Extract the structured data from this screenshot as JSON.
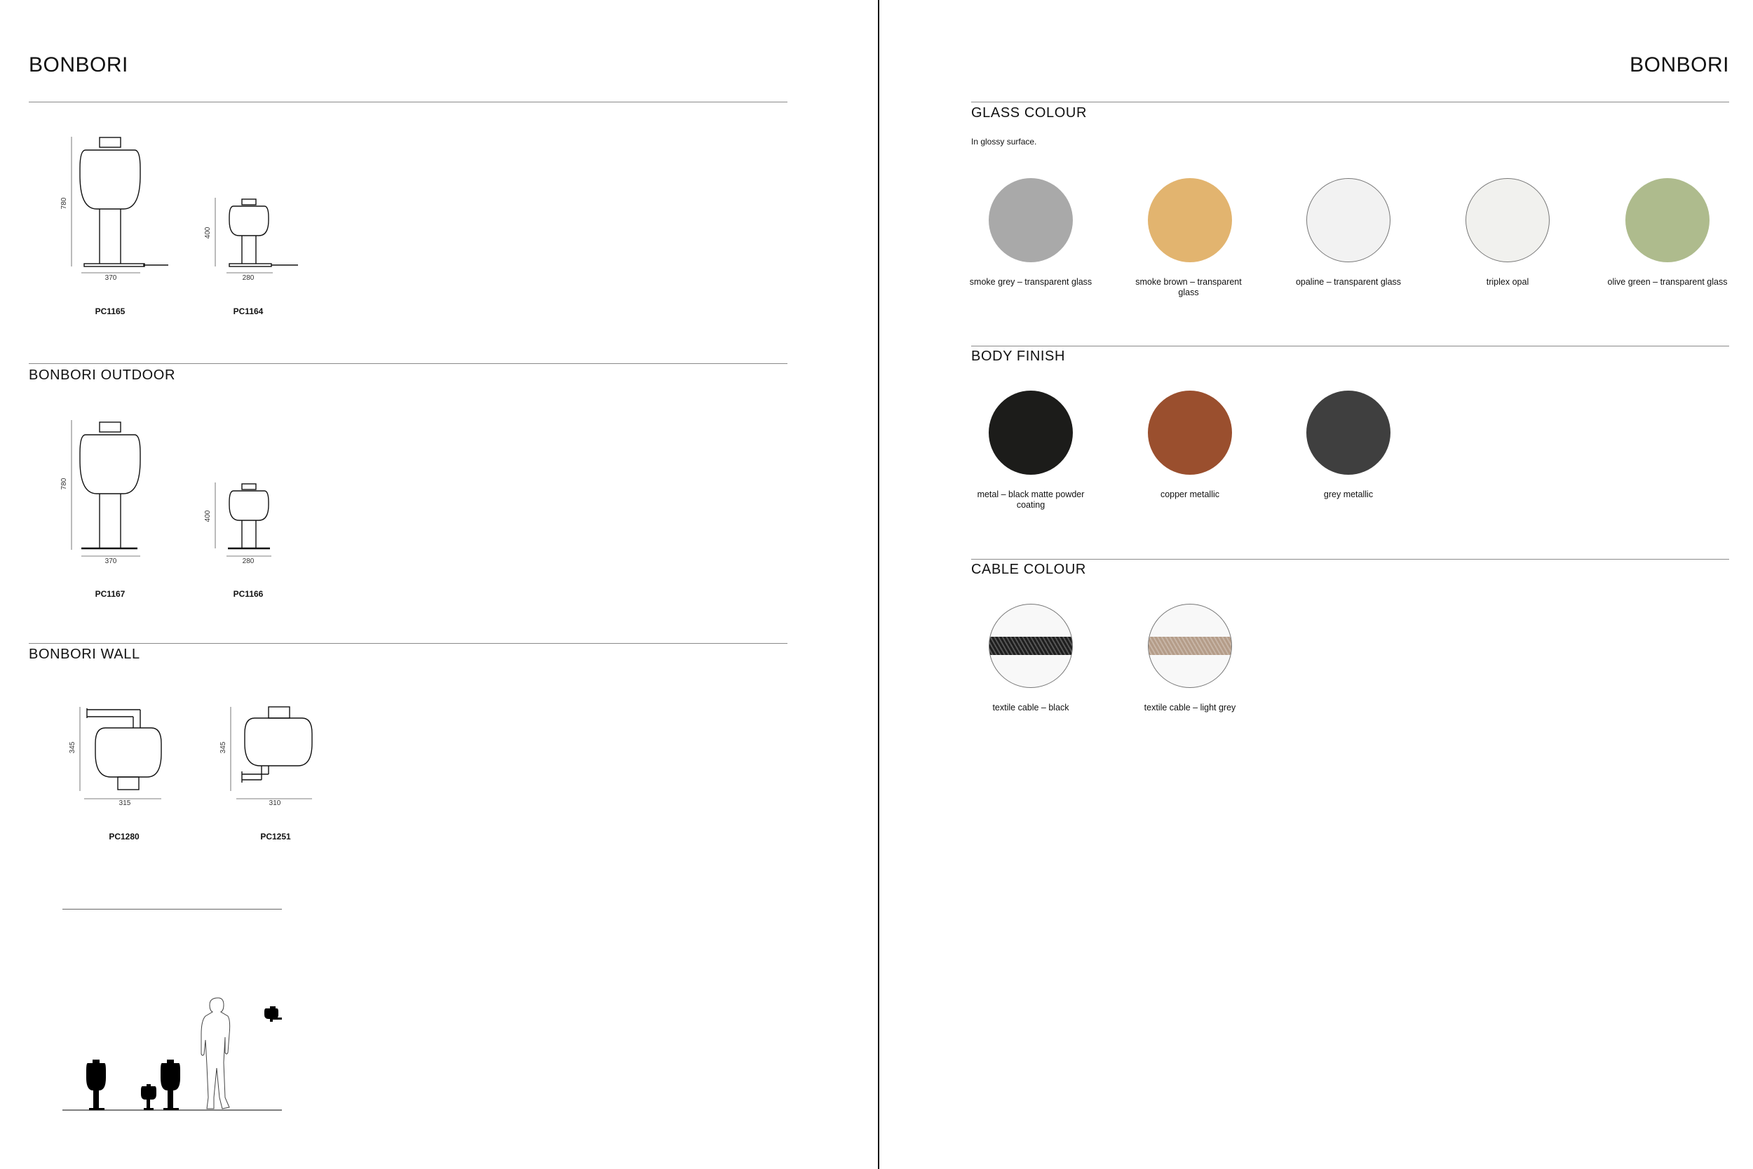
{
  "left_page": {
    "title": "BONBORI",
    "sections": [
      {
        "heading": "",
        "items": [
          {
            "code": "PC1165",
            "height": "780",
            "width": "370"
          },
          {
            "code": "PC1164",
            "height": "400",
            "width": "280"
          }
        ]
      },
      {
        "heading": "BONBORI OUTDOOR",
        "items": [
          {
            "code": "PC1167",
            "height": "780",
            "width": "370"
          },
          {
            "code": "PC1166",
            "height": "400",
            "width": "280"
          }
        ]
      },
      {
        "heading": "BONBORI WALL",
        "items": [
          {
            "code": "PC1280",
            "height": "345",
            "width": "315"
          },
          {
            "code": "PC1251",
            "height": "345",
            "width": "310"
          }
        ]
      }
    ]
  },
  "right_page": {
    "title": "BONBORI",
    "glass": {
      "heading": "GLASS COLOUR",
      "note": "In glossy surface.",
      "swatches": [
        {
          "label": "smoke grey – transparent glass",
          "color": "#a9a9a9"
        },
        {
          "label": "smoke brown – transparent glass",
          "color": "#e2b46f"
        },
        {
          "label": "opaline – transparent glass",
          "color": "#f2f2f2"
        },
        {
          "label": "triplex opal",
          "color": "#f1f1ee"
        },
        {
          "label": "olive green – transparent glass",
          "color": "#aebb8d"
        }
      ]
    },
    "body": {
      "heading": "BODY FINISH",
      "swatches": [
        {
          "label": "metal – black matte powder coating",
          "color": "#1c1c1a"
        },
        {
          "label": "copper metallic",
          "color": "#9a4f2e"
        },
        {
          "label": "grey metallic",
          "color": "#3f3f3f"
        }
      ]
    },
    "cable": {
      "heading": "CABLE COLOUR",
      "swatches": [
        {
          "label": "textile cable – black",
          "color": "#1e1e1e"
        },
        {
          "label": "textile cable – light grey",
          "color": "#b49c88"
        }
      ]
    }
  }
}
